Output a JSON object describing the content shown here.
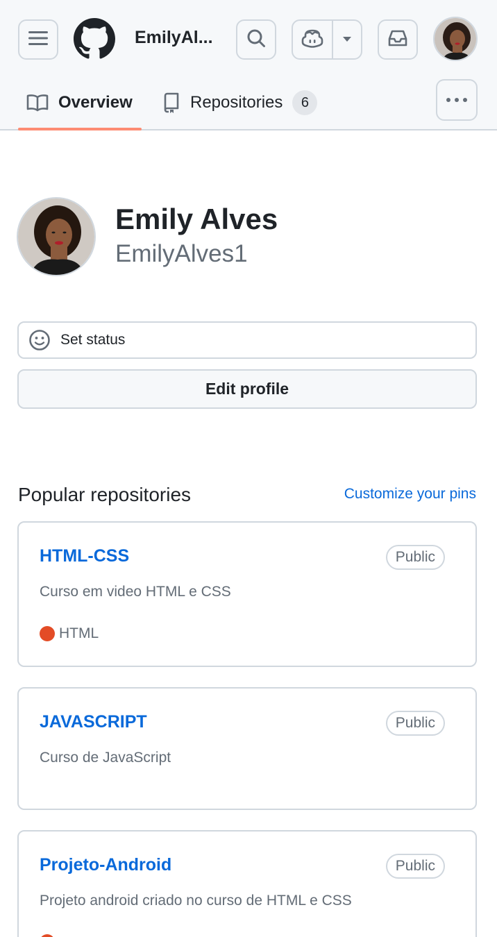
{
  "header": {
    "username": "EmilyAl...",
    "tabs": [
      {
        "label": "Overview"
      },
      {
        "label": "Repositories",
        "count": "6"
      }
    ]
  },
  "profile": {
    "name": "Emily Alves",
    "login": "EmilyAlves1",
    "set_status_label": "Set status",
    "edit_profile_label": "Edit profile"
  },
  "popular": {
    "title": "Popular repositories",
    "customize_label": "Customize your pins",
    "repos": [
      {
        "name": "HTML-CSS",
        "visibility": "Public",
        "description": "Curso em video HTML e CSS",
        "language": "HTML",
        "language_color": "#e34c26"
      },
      {
        "name": "JAVASCRIPT",
        "visibility": "Public",
        "description": "Curso de JavaScript"
      },
      {
        "name": "Projeto-Android",
        "visibility": "Public",
        "description": "Projeto android criado no curso de HTML e CSS",
        "language_color": "#e34c26"
      }
    ]
  },
  "colors": {
    "accent_link": "#0969da",
    "tab_underline": "#fd8c73",
    "border": "#d0d7de"
  },
  "icons": [
    "hamburger-icon",
    "github-logo-icon",
    "search-icon",
    "copilot-icon",
    "caret-down-icon",
    "inbox-icon",
    "book-icon",
    "repo-icon",
    "kebab-icon",
    "smiley-icon"
  ]
}
